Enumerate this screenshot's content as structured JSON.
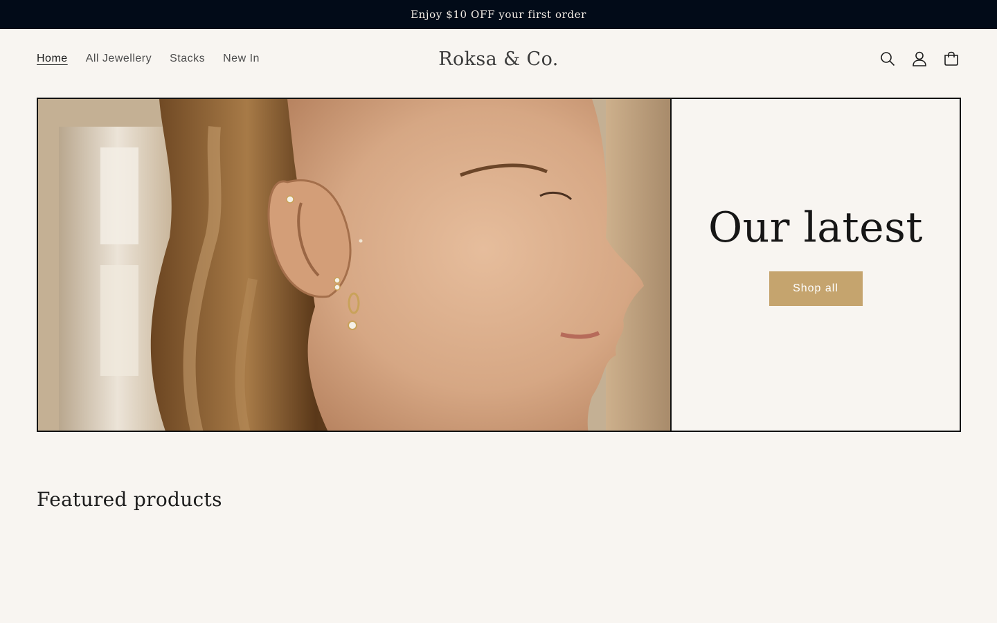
{
  "announcement": {
    "text": "Enjoy $10 OFF your first order"
  },
  "header": {
    "nav": [
      {
        "label": "Home",
        "active": true
      },
      {
        "label": "All Jewellery",
        "active": false
      },
      {
        "label": "Stacks",
        "active": false
      },
      {
        "label": "New In",
        "active": false
      }
    ],
    "logo": "Roksa & Co.",
    "icons": [
      "search-icon",
      "account-icon",
      "cart-icon"
    ]
  },
  "hero": {
    "image_alt": "",
    "heading": "Our latest",
    "button_label": "Shop all"
  },
  "featured": {
    "title": "Featured products"
  },
  "colors": {
    "announcement_bg": "#020b18",
    "page_bg": "#f8f5f1",
    "accent_button": "#c5a46e",
    "border": "#111111"
  }
}
